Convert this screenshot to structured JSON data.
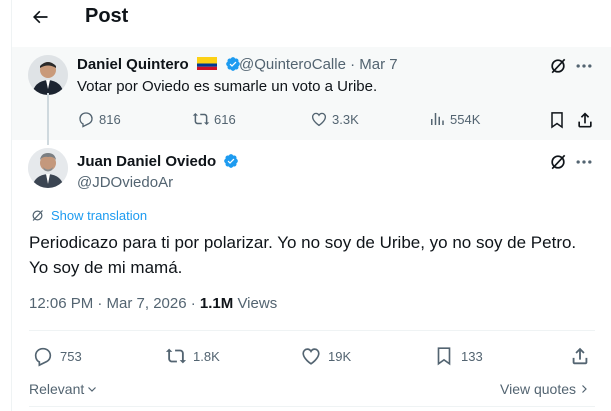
{
  "header": {
    "title": "Post"
  },
  "quoted_post": {
    "author_name": "Daniel Quintero",
    "handle": "@QuinteroCalle",
    "date": "· Mar 7",
    "text": "Votar por Oviedo es sumarle un voto a Uribe.",
    "replies": "816",
    "reposts": "616",
    "likes": "3.3K",
    "views": "554K"
  },
  "main_post": {
    "author_name": "Juan Daniel Oviedo",
    "handle": "@JDOviedoAr",
    "translate_label": "Show translation",
    "text": "Periodicazo para ti por polarizar. Yo no soy de Uribe, yo no soy de Petro.\nYo soy de mi mamá.",
    "time": "12:06 PM · Mar 7, 2026 ·",
    "views_count": "1.1M",
    "views_label": "Views",
    "replies": "753",
    "reposts": "1.8K",
    "likes": "19K",
    "bookmarks": "133"
  },
  "footer": {
    "sort_label": "Relevant",
    "quotes_label": "View quotes"
  },
  "colors": {
    "accent": "#1d9bf0",
    "muted": "#536471",
    "verified": "#1d9bf0"
  },
  "icons": [
    "back-arrow-icon",
    "grok-icon",
    "more-icon",
    "reply-icon",
    "repost-icon",
    "like-icon",
    "views-icon",
    "bookmark-icon",
    "share-icon",
    "translate-icon",
    "verified-icon",
    "colombia-flag-icon",
    "chevron-down-icon",
    "chevron-right-icon"
  ]
}
